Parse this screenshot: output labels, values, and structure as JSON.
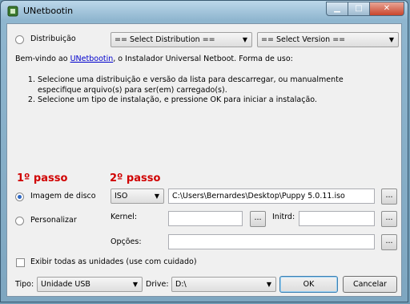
{
  "window": {
    "title": "UNetbootin"
  },
  "distribution": {
    "label": "Distribuição",
    "select_distribution": "== Select Distribution ==",
    "select_version": "== Select Version =="
  },
  "intro": {
    "prefix": "Bem-vindo ao ",
    "link": "UNetbootin",
    "suffix": ", o Instalador Universal Netboot. Forma de uso:",
    "steps": [
      "Selecione uma distribuição e versão da lista para descarregar, ou manualmente especifique arquivo(s) para ser(em) carregado(s).",
      "Selecione um tipo de instalação, e pressione OK para iniciar a instalação."
    ]
  },
  "annotations": {
    "step1": "1º passo",
    "step2": "2º passo"
  },
  "disk_image": {
    "label": "Imagem de disco",
    "type": "ISO",
    "path": "C:\\Users\\Bernardes\\Desktop\\Puppy 5.0.11.iso",
    "browse": "..."
  },
  "custom": {
    "label": "Personalizar",
    "kernel_label": "Kernel:",
    "initrd_label": "Initrd:",
    "options_label": "Opções:",
    "browse": "..."
  },
  "show_all_drives": {
    "label": "Exibir todas as unidades (use com cuidado)"
  },
  "footer": {
    "type_label": "Tipo:",
    "type_value": "Unidade USB",
    "drive_label": "Drive:",
    "drive_value": "D:\\",
    "ok": "OK",
    "cancel": "Cancelar"
  },
  "colors": {
    "step_annotation": "#d00000",
    "link": "#0000cc"
  }
}
